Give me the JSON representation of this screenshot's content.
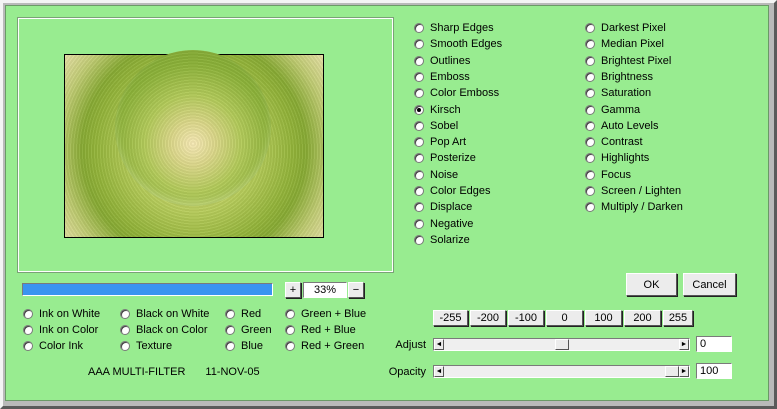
{
  "preview": {
    "zoom_value": "33%",
    "zoom_in_label": "+",
    "zoom_out_label": "−",
    "progress": 1.0
  },
  "filters_col1": [
    {
      "label": "Sharp Edges",
      "checked": false
    },
    {
      "label": "Smooth Edges",
      "checked": false
    },
    {
      "label": "Outlines",
      "checked": false
    },
    {
      "label": "Emboss",
      "checked": false
    },
    {
      "label": "Color Emboss",
      "checked": false
    },
    {
      "label": "Kirsch",
      "checked": true
    },
    {
      "label": "Sobel",
      "checked": false
    },
    {
      "label": "Pop Art",
      "checked": false
    },
    {
      "label": "Posterize",
      "checked": false
    },
    {
      "label": "Noise",
      "checked": false
    },
    {
      "label": "Color Edges",
      "checked": false
    },
    {
      "label": "Displace",
      "checked": false
    },
    {
      "label": "Negative",
      "checked": false
    },
    {
      "label": "Solarize",
      "checked": false
    }
  ],
  "filters_col2": [
    {
      "label": "Darkest Pixel",
      "checked": false
    },
    {
      "label": "Median Pixel",
      "checked": false
    },
    {
      "label": "Brightest Pixel",
      "checked": false
    },
    {
      "label": "Brightness",
      "checked": false
    },
    {
      "label": "Saturation",
      "checked": false
    },
    {
      "label": "Gamma",
      "checked": false
    },
    {
      "label": "Auto Levels",
      "checked": false
    },
    {
      "label": "Contrast",
      "checked": false
    },
    {
      "label": "Highlights",
      "checked": false
    },
    {
      "label": "Focus",
      "checked": false
    },
    {
      "label": "Screen / Lighten",
      "checked": false
    },
    {
      "label": "Multiply / Darken",
      "checked": false
    }
  ],
  "modes": [
    [
      {
        "label": "Ink on White",
        "checked": false
      },
      {
        "label": "Ink on Color",
        "checked": false
      },
      {
        "label": "Color Ink",
        "checked": false
      }
    ],
    [
      {
        "label": "Black on White",
        "checked": false
      },
      {
        "label": "Black on Color",
        "checked": false
      },
      {
        "label": "Texture",
        "checked": false
      }
    ],
    [
      {
        "label": "Red",
        "checked": false
      },
      {
        "label": "Green",
        "checked": false
      },
      {
        "label": "Blue",
        "checked": false
      }
    ],
    [
      {
        "label": "Green +  Blue",
        "checked": false
      },
      {
        "label": "Red +  Blue",
        "checked": false
      },
      {
        "label": "Red + Green",
        "checked": false
      }
    ]
  ],
  "credit": {
    "name": "AAA MULTI-FILTER",
    "date": "11-NOV-05"
  },
  "buttons": {
    "ok": "OK",
    "cancel": "Cancel"
  },
  "presets": [
    "-255",
    "-200",
    "-100",
    "0",
    "100",
    "200",
    "255"
  ],
  "adjust": {
    "label": "Adjust",
    "value": "0",
    "level": 0
  },
  "opacity": {
    "label": "Opacity",
    "value": "100",
    "level": 100
  },
  "colors": {
    "panel": "#98ec90",
    "progress_fill": "#3a94f0"
  }
}
